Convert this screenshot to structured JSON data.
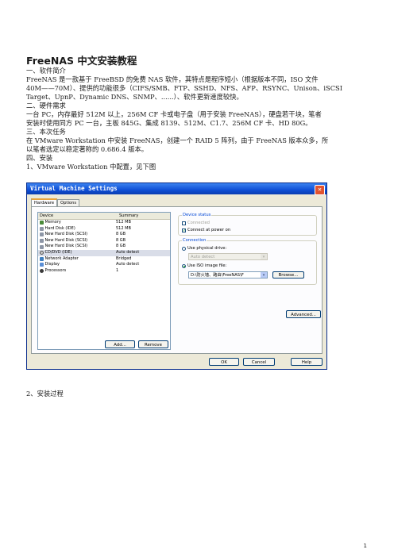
{
  "doc": {
    "title": "FreeNAS 中文安装教程",
    "lines": [
      "一、软件简介",
      "FreeNAS 是一款基于 FreeBSD 的免费 NAS 软件，其特点是程序短小（根据版本不同，ISO 文件",
      "40M——70M）、提供的功能很多（CIFS/SMB、FTP、SSHD、NFS、AFP、RSYNC、Unison、iSCSI",
      "Target、UpnP、Dynamic DNS、SNMP、......）、软件更新速度较快。",
      "二、硬件需求",
      "一台 PC，内存最好 512M 以上，256M CF 卡或电子盘（用于安装 FreeNAS），硬盘若干块，笔者",
      "安装时使用同方 PC 一台，主板 845G、集成 8139、512M、C1.7、256M CF 卡、HD 80G。",
      "三、本次任务",
      "在 VMware Workstation 中安装 FreeNAS，创建一个 RAID 5 阵列，由于 FreeNAS 版本众多，所",
      "以笔者选定以稳定著称的 0.686.4 版本。",
      "四、安装",
      "1、VMware Workstation 中配置，见下图"
    ],
    "after_figure": "2、安装过程",
    "page_number": "1"
  },
  "dialog": {
    "title": "Virtual Machine Settings",
    "close_glyph": "✕",
    "tabs": [
      "Hardware",
      "Options"
    ],
    "columns": [
      "Device",
      "Summary"
    ],
    "devices": [
      {
        "name": "Memory",
        "summary": "512 MB",
        "icon": "memory-icon"
      },
      {
        "name": "Hard Disk (IDE)",
        "summary": "512 MB",
        "icon": "hard-disk-icon"
      },
      {
        "name": "New Hard Disk (SCSI)",
        "summary": "8 GB",
        "icon": "hard-disk-icon"
      },
      {
        "name": "New Hard Disk (SCSI)",
        "summary": "8 GB",
        "icon": "hard-disk-icon"
      },
      {
        "name": "New Hard Disk (SCSI)",
        "summary": "8 GB",
        "icon": "hard-disk-icon"
      },
      {
        "name": "CD/DVD (IDE)",
        "summary": "Auto detect",
        "icon": "cd-dvd-icon",
        "selected": true
      },
      {
        "name": "Network Adapter",
        "summary": "Bridged",
        "icon": "network-adapter-icon"
      },
      {
        "name": "Display",
        "summary": "Auto detect",
        "icon": "display-icon"
      },
      {
        "name": "Processors",
        "summary": "1",
        "icon": "processor-icon"
      }
    ],
    "add_label": "Add...",
    "remove_label": "Remove",
    "device_status": {
      "title": "Device status",
      "connected": "Connected",
      "connect_power_on": "Connect at power on"
    },
    "connection": {
      "title": "Connection",
      "use_physical": "Use physical drive:",
      "physical_value": "Auto detect",
      "use_iso": "Use ISO image file:",
      "iso_value": "D:\\防火墙、路由\\FreeNAS\\F",
      "browse_label": "Browse..."
    },
    "advanced_label": "Advanced...",
    "ok_label": "OK",
    "cancel_label": "Cancel",
    "help_label": "Help",
    "colors": {
      "titlebar": "#0f4fd6",
      "group_title": "#0046d5",
      "checkmark": "#21a121"
    }
  }
}
